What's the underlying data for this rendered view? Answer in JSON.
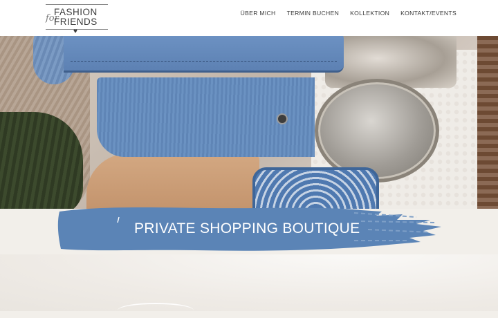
{
  "brand": {
    "line1": "FASHION",
    "line2": "FRIENDS",
    "script": "for",
    "heart": "♥"
  },
  "nav": {
    "items": [
      {
        "label": "ÜBER MICH"
      },
      {
        "label": "TERMIN BUCHEN"
      },
      {
        "label": "KOLLEKTION"
      },
      {
        "label": "KONTAKT/EVENTS"
      }
    ]
  },
  "hero": {
    "title": "PRIVATE SHOPPING BOUTIQUE"
  },
  "colors": {
    "brush": "#5b84b6",
    "header_bg": "#ffffff",
    "nav_text": "#3a3a3a"
  }
}
